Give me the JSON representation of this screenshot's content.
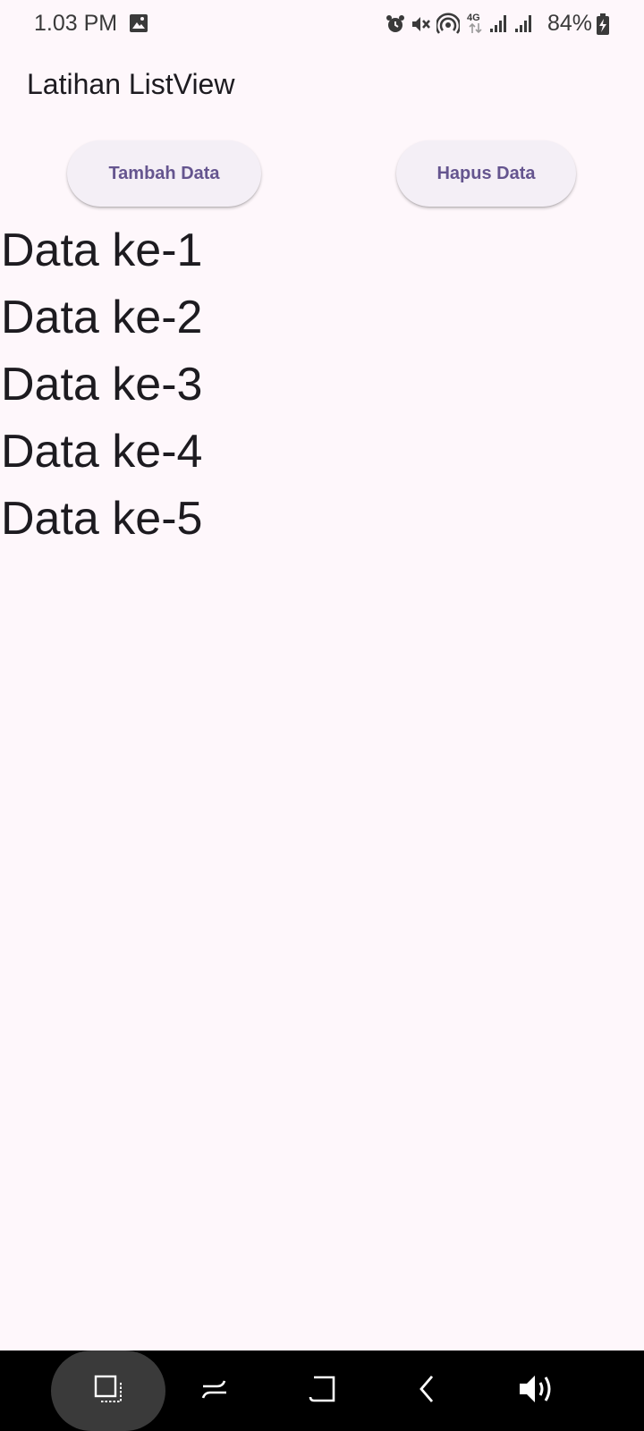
{
  "status_bar": {
    "time": "1.03 PM",
    "battery": "84%",
    "icons": [
      "image-icon",
      "alarm-icon",
      "mute-icon",
      "hotspot-icon",
      "4g-icon",
      "signal-icon",
      "signal-icon",
      "battery-icon"
    ]
  },
  "app_bar": {
    "title": "Latihan ListView"
  },
  "buttons": {
    "add_label": "Tambah Data",
    "delete_label": "Hapus Data"
  },
  "list": {
    "items": [
      "Data ke-1",
      "Data ke-2",
      "Data ke-3",
      "Data ke-4",
      "Data ke-5"
    ]
  },
  "nav_bar": {
    "icons": [
      "screenshot-icon",
      "multitask-icon",
      "home-icon",
      "back-icon",
      "volume-icon"
    ]
  },
  "colors": {
    "background": "#fef7fb",
    "button_bg": "#f4eff6",
    "button_text": "#65558f",
    "text": "#1d1b20",
    "nav_bg": "#000000"
  }
}
